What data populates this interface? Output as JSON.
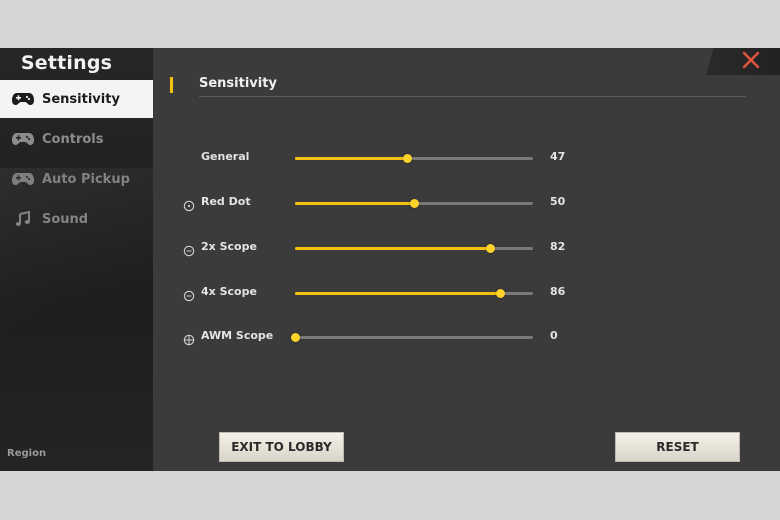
{
  "sidebar": {
    "title": "Settings",
    "items": [
      {
        "label": "Sensitivity",
        "icon": "gamepad-icon",
        "active": true
      },
      {
        "label": "Controls",
        "icon": "gamepad-icon",
        "active": false
      },
      {
        "label": "Auto Pickup",
        "icon": "gamepad-icon",
        "active": false
      },
      {
        "label": "Sound",
        "icon": "music-note-icon",
        "active": false
      }
    ],
    "region_label": "Region"
  },
  "header": {
    "title": "Sensitivity"
  },
  "sliders": [
    {
      "label": "General",
      "value": "47",
      "icon": ""
    },
    {
      "label": "Red Dot",
      "value": "50",
      "icon": "red-dot-scope-icon"
    },
    {
      "label": "2x Scope",
      "value": "82",
      "icon": "2x-scope-icon"
    },
    {
      "label": "4x Scope",
      "value": "86",
      "icon": "4x-scope-icon"
    },
    {
      "label": "AWM Scope",
      "value": "0",
      "icon": "awm-scope-icon"
    }
  ],
  "slider_max": 100,
  "buttons": {
    "exit": "EXIT TO LOBBY",
    "reset": "RESET"
  },
  "colors": {
    "accent": "#f4c20d",
    "close": "#e0533c"
  }
}
